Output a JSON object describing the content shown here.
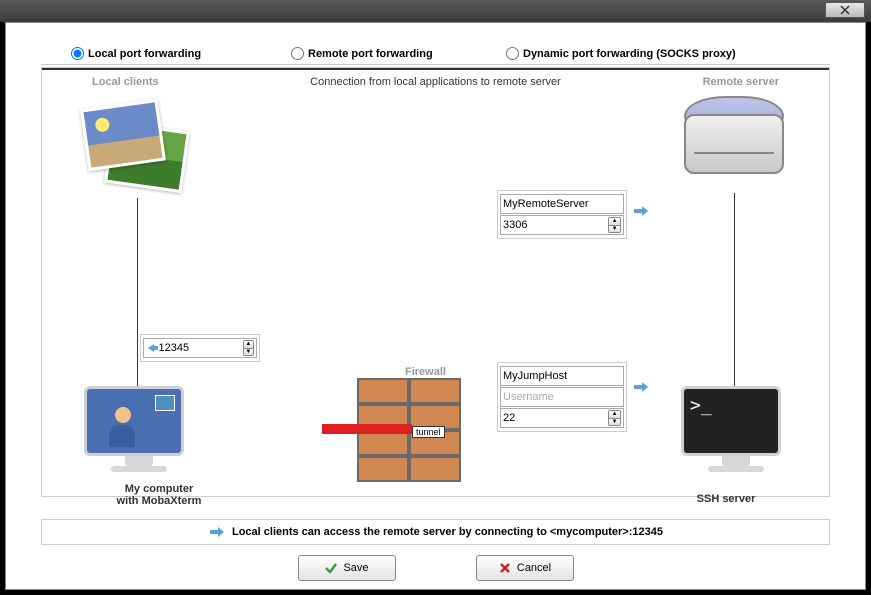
{
  "radios": {
    "local": "Local port forwarding",
    "remote": "Remote port forwarding",
    "dynamic": "Dynamic port forwarding (SOCKS proxy)"
  },
  "subtitle": "Connection from local applications to remote server",
  "labels": {
    "localClients": "Local clients",
    "remoteServer": "Remote server",
    "firewall": "Firewall",
    "tunnel": "tunnel",
    "myComputer1": "My computer",
    "myComputer2": "with MobaXterm",
    "sshServer": "SSH server"
  },
  "fields": {
    "localPort": "12345",
    "remoteHost": "MyRemoteServer",
    "remotePort": "3306",
    "jumpHost": "MyJumpHost",
    "jumpUserPlaceholder": "Username",
    "jumpPort": "22"
  },
  "help": "Local clients can access the remote server by connecting to <mycomputer>:12345",
  "buttons": {
    "save": "Save",
    "cancel": "Cancel"
  },
  "terminal": ">_"
}
